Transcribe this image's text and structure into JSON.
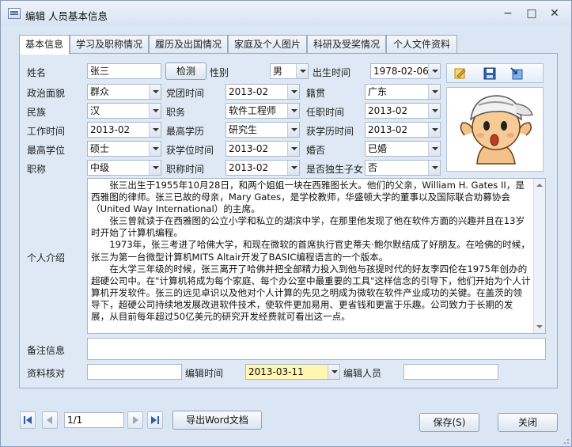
{
  "window": {
    "title": "编辑 人员基本信息",
    "minimize": "−",
    "restore": "□",
    "close": "✕"
  },
  "tabs": [
    "基本信息",
    "学习及职称情况",
    "履历及出国情况",
    "家庭及个人图片",
    "科研及受奖情况",
    "个人文件资料"
  ],
  "form": {
    "name_label": "姓名",
    "name_value": "张三",
    "check_button": "检测",
    "gender_label": "性别",
    "gender_value": "男",
    "birth_label": "出生时间",
    "birth_value": "1978-02-06",
    "political_label": "政治面貌",
    "political_value": "群众",
    "party_label": "党团时间",
    "party_value": "2013-02",
    "native_label": "籍贯",
    "native_value": "广东",
    "ethnic_label": "民族",
    "ethnic_value": "汉",
    "post_label": "职务",
    "post_value": "软件工程师",
    "appoint_label": "任职时间",
    "appoint_value": "2013-02",
    "work_label": "工作时间",
    "work_value": "2013-02",
    "edu_label": "最高学历",
    "edu_value": "研究生",
    "edu_time_label": "获学历时间",
    "edu_time_value": "2013-02",
    "degree_label": "最高学位",
    "degree_value": "硕士",
    "degree_time_label": "获学位时间",
    "degree_time_value": "2013-02",
    "marriage_label": "婚否",
    "marriage_value": "已婚",
    "title_label": "职称",
    "title_value": "中级",
    "title_time_label": "职称时间",
    "title_time_value": "2013-02",
    "only_child_label": "是否独生子女",
    "only_child_value": "否",
    "intro_label": "个人介绍",
    "intro_paragraphs": [
      "张三出生于1955年10月28日，和两个姐姐一块在西雅图长大。他们的父亲，William H. Gates II，是西雅图的律师。张三已故的母亲，Mary Gates，是学校教师，华盛顿大学的董事以及国际联合劝募协会（United Way International）的主席。",
      "张三曾就读于在西雅图的公立小学和私立的湖滨中学，在那里他发现了他在软件方面的兴趣并且在13岁时开始了计算机编程。",
      "1973年，张三考进了哈佛大学，和现在微软的首席执行官史蒂夫·鲍尔默结成了好朋友。在哈佛的时候，张三为第一台微型计算机MITS Altair开发了BASIC编程语言的一个版本。",
      "在大学三年级的时候，张三离开了哈佛并把全部精力投入到他与孩提时代的好友李四伦在1975年创办的超硬公司中。在\"计算机将成为每个家庭、每个办公室中最重要的工具\"这样信念的引导下，他们开始为个人计算机开发软件。张三的远见卓识以及他对个人计算的先见之明成为微软在软件产业成功的关键。在盖茨的领导下，超硬公司持续地发展改进软件技术，使软件更加易用、更省钱和更富于乐趣。公司致力于长期的发展，从目前每年超过50亿美元的研究开发经费就可看出这一点。"
    ],
    "remark_label": "备注信息",
    "remark_value": "",
    "verify_label": "资料核对",
    "verify_value": "",
    "edit_time_label": "编辑时间",
    "edit_time_value": "2013-03-11",
    "editor_label": "编辑人员",
    "editor_value": ""
  },
  "toolbar_icons": [
    "edit-photo-icon",
    "save-photo-icon",
    "import-photo-icon"
  ],
  "footer": {
    "page_value": "1/1",
    "export_button": "导出Word文档",
    "save_button": "保存(S)",
    "close_button": "关闭"
  },
  "colors": {
    "accent": "#3c6fb4",
    "highlight": "#fff6b0"
  }
}
